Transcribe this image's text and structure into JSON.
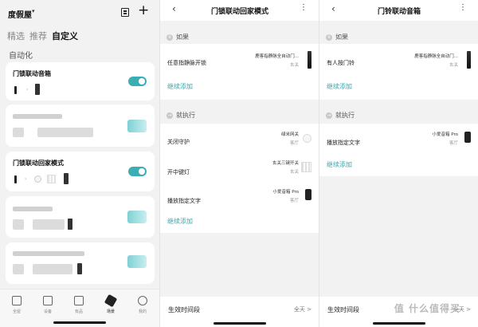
{
  "home": {
    "title": "度假屋",
    "tabs": [
      "精选",
      "推荐",
      "自定义"
    ],
    "section": "自动化",
    "cards": [
      {
        "title": "门锁联动音箱",
        "enabled": true
      },
      {
        "title": "",
        "enabled": true
      },
      {
        "title": "门锁联动回家模式",
        "enabled": true
      },
      {
        "title": "",
        "enabled": true
      },
      {
        "title": "",
        "enabled": true
      }
    ],
    "nav": [
      {
        "label": "全屋"
      },
      {
        "label": "设备"
      },
      {
        "label": "有品"
      },
      {
        "label": "场景"
      },
      {
        "label": "我的"
      }
    ]
  },
  "scene1": {
    "title": "门锁联动回家模式",
    "if_label": "如果",
    "if_items": [
      {
        "label": "任意指静脉开锁",
        "device": "鹿客指静脉全自动门...",
        "room": "玄关"
      }
    ],
    "continue_label": "继续添加",
    "then_label": "就执行",
    "then_items": [
      {
        "label": "关闭守护",
        "device": "绿米网关",
        "room": "客厅"
      },
      {
        "label": "开中键灯",
        "device": "玄关三键开关",
        "room": "玄关"
      },
      {
        "label": "播放指定文字",
        "device": "小爱音箱 Pro",
        "room": "客厅"
      }
    ],
    "then_continue": "继续添加",
    "effective_label": "生效时间段",
    "effective_value": "全天 >"
  },
  "scene2": {
    "title": "门铃联动音箱",
    "if_label": "如果",
    "if_items": [
      {
        "label": "有人按门铃",
        "device": "鹿客指静脉全自动门...",
        "room": "玄关"
      }
    ],
    "continue_label": "继续添加",
    "then_label": "就执行",
    "then_items": [
      {
        "label": "播放指定文字",
        "device": "小爱音箱 Pro",
        "room": "客厅"
      }
    ],
    "then_continue": "继续添加",
    "effective_label": "生效时间段",
    "effective_value": "全天 >"
  },
  "watermark": "值 什么值得买",
  "colors": {
    "accent": "#3aaeb3",
    "background": "#f2f2f2"
  }
}
